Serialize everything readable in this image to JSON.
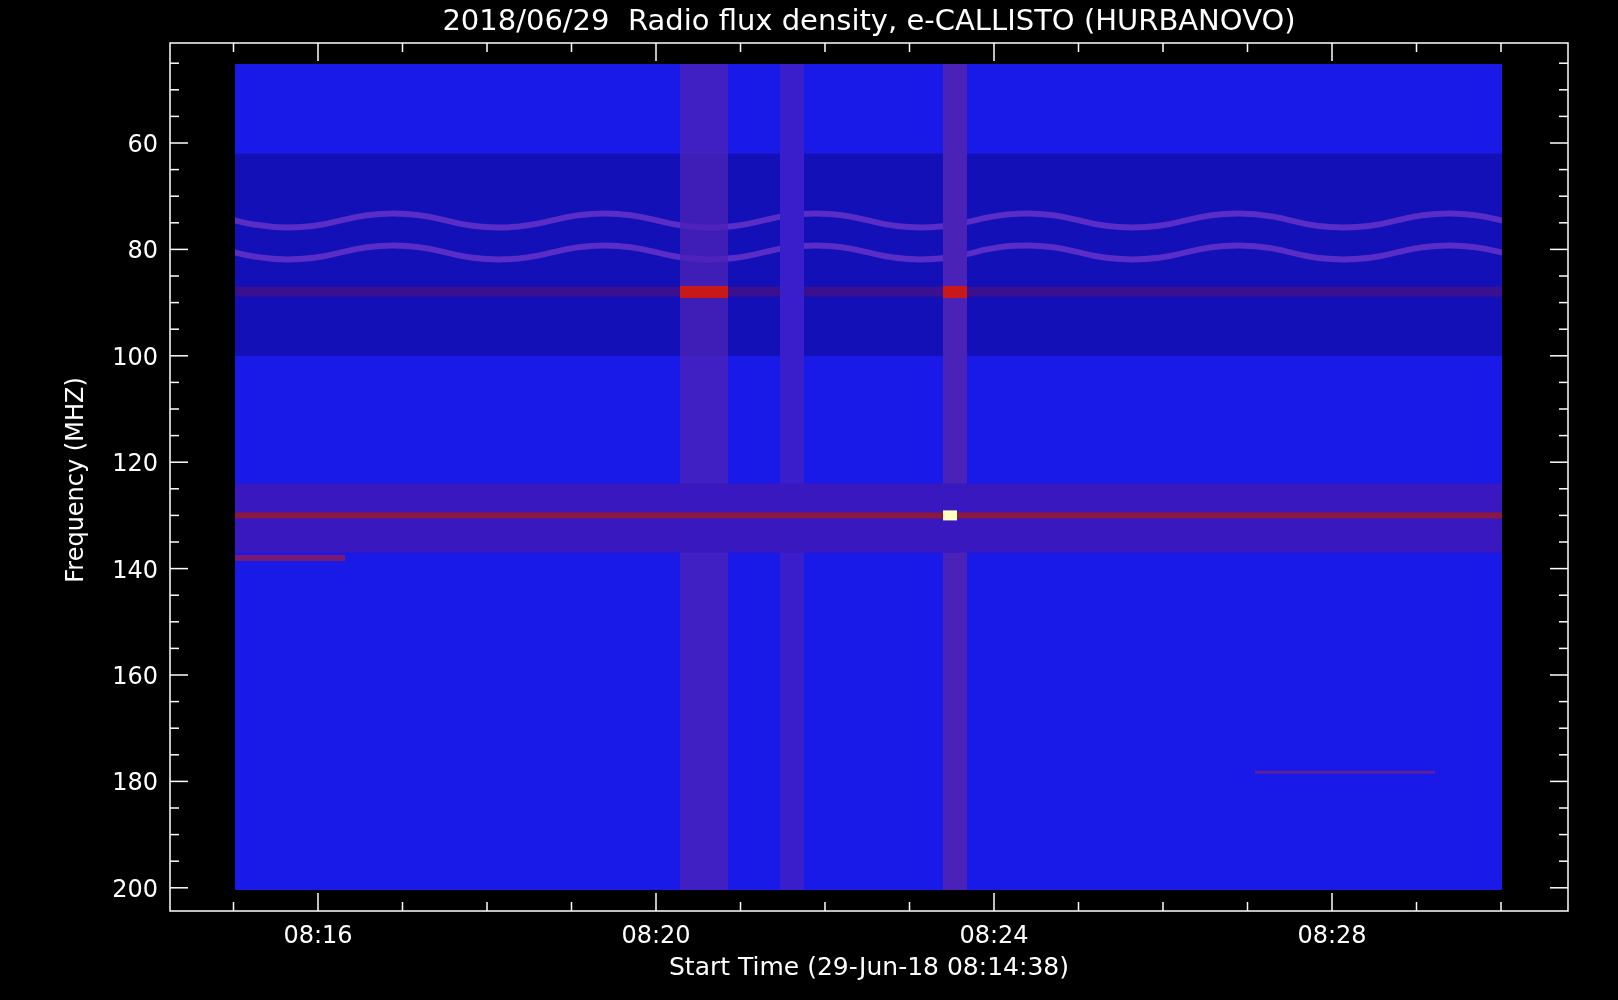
{
  "title": "2018/06/29  Radio flux density, e-CALLISTO (HURBANOVO)",
  "y_axis": {
    "label": "Frequency (MHZ)",
    "ticks": [
      "60",
      "80",
      "100",
      "120",
      "140",
      "160",
      "180",
      "200"
    ]
  },
  "x_axis": {
    "label": "Start Time (29-Jun-18 08:14:38)",
    "ticks": [
      "08:16",
      "08:20",
      "08:24",
      "08:28"
    ]
  }
}
